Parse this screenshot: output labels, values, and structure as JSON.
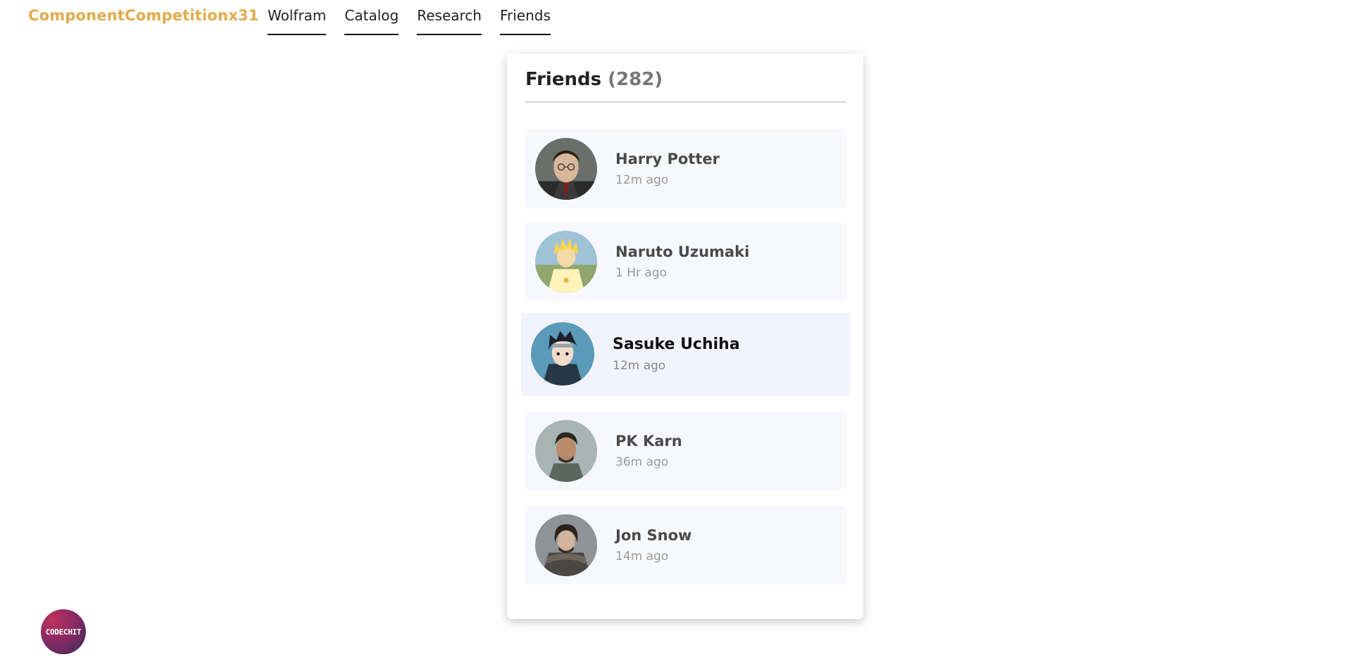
{
  "brand": "ComponentCompetitionx31",
  "nav": {
    "links": [
      "Wolfram",
      "Catalog",
      "Research",
      "Friends"
    ]
  },
  "friends": {
    "title": "Friends",
    "count": "(282)",
    "items": [
      {
        "name": "Harry Potter",
        "time": "12m ago"
      },
      {
        "name": "Naruto Uzumaki",
        "time": "1 Hr ago"
      },
      {
        "name": "Sasuke Uchiha",
        "time": "12m ago"
      },
      {
        "name": "PK Karn",
        "time": "36m ago"
      },
      {
        "name": "Jon Snow",
        "time": "14m ago"
      }
    ]
  },
  "badge": {
    "label": "CODECHIT"
  },
  "colors": {
    "brand": "#e3aa4c",
    "item_bg": "#f7f8fd",
    "active_item_bg": "#f2f3fc"
  }
}
